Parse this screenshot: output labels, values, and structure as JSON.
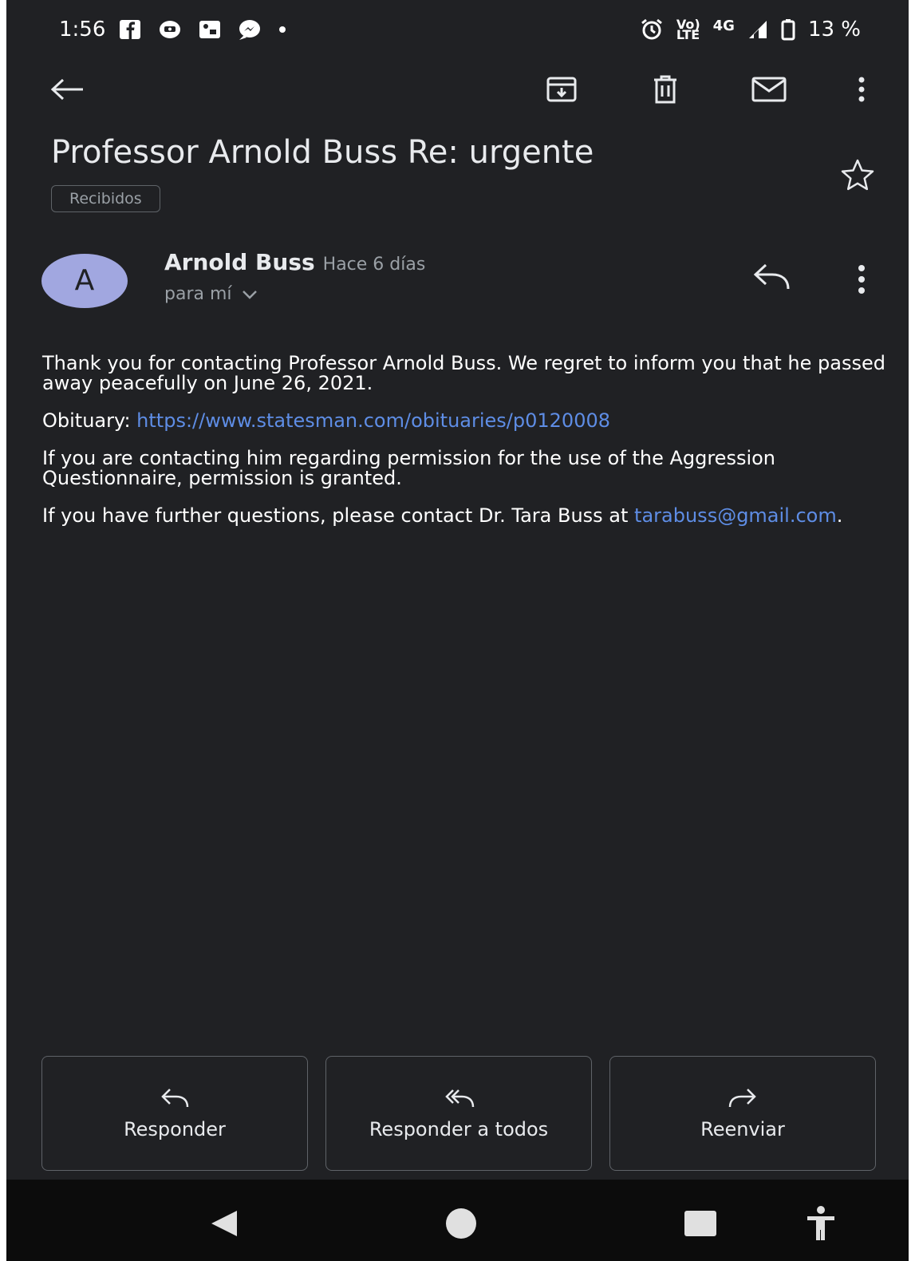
{
  "status_bar": {
    "time": "1:56",
    "net_top": "Vo)",
    "net_bottom": "LTE",
    "network": "4G",
    "battery": "13 %"
  },
  "email": {
    "subject": "Professor Arnold Buss Re: urgente",
    "label": "Recibidos",
    "sender": {
      "avatar_initial": "A",
      "name": "Arnold Buss",
      "time": "Hace 6 días",
      "recipients": "para mí"
    },
    "body": {
      "p1": "Thank you for contacting Professor Arnold Buss. We regret to inform you that he passed away peacefully on June 26, 2021.",
      "p2_prefix": "Obituary:",
      "p2_link": "https://www.statesman.com/obituaries/p0120008",
      "p3": "If you are contacting him regarding permission for the use of the Aggression Questionnaire, permission is granted.",
      "p4_prefix": "If you have further questions, please contact Dr. Tara Buss at",
      "p4_email": "tarabuss@gmail.com",
      "p4_suffix": "."
    }
  },
  "actions": {
    "reply": "Responder",
    "reply_all": "Responder a todos",
    "forward": "Reenviar"
  },
  "colors": {
    "background": "#202124",
    "text": "#e8eaed",
    "link": "#5e8de5",
    "avatar": "#a1a7e0"
  },
  "icons": [
    "back-arrow-icon",
    "archive-icon",
    "trash-icon",
    "mail-icon",
    "more-vert-icon",
    "star-icon",
    "reply-icon",
    "reply-all-icon",
    "forward-icon",
    "nav-back-icon",
    "nav-home-icon",
    "nav-recents-icon",
    "accessibility-icon"
  ]
}
